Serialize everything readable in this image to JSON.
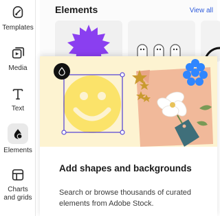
{
  "sidebar": {
    "items": [
      {
        "label": "Templates",
        "icon": "templates-icon"
      },
      {
        "label": "Media",
        "icon": "media-icon"
      },
      {
        "label": "Text",
        "icon": "text-icon"
      },
      {
        "label": "Elements",
        "icon": "elements-icon",
        "active": true
      },
      {
        "label": "Charts and grids",
        "icon": "charts-grids-icon"
      }
    ]
  },
  "panel": {
    "title": "Elements",
    "view_all": "View all"
  },
  "promo": {
    "title": "Add shapes and backgrounds",
    "description": "Search or browse thousands of curated elements from Adobe Stock."
  },
  "colors": {
    "accent_link": "#2e5bdb",
    "hero_bg": "#fdf3d1",
    "smiley": "#fbe36a",
    "burst": "#8a3ff0",
    "flower_blue": "#2f86ff",
    "selection": "#5a4ad6"
  }
}
